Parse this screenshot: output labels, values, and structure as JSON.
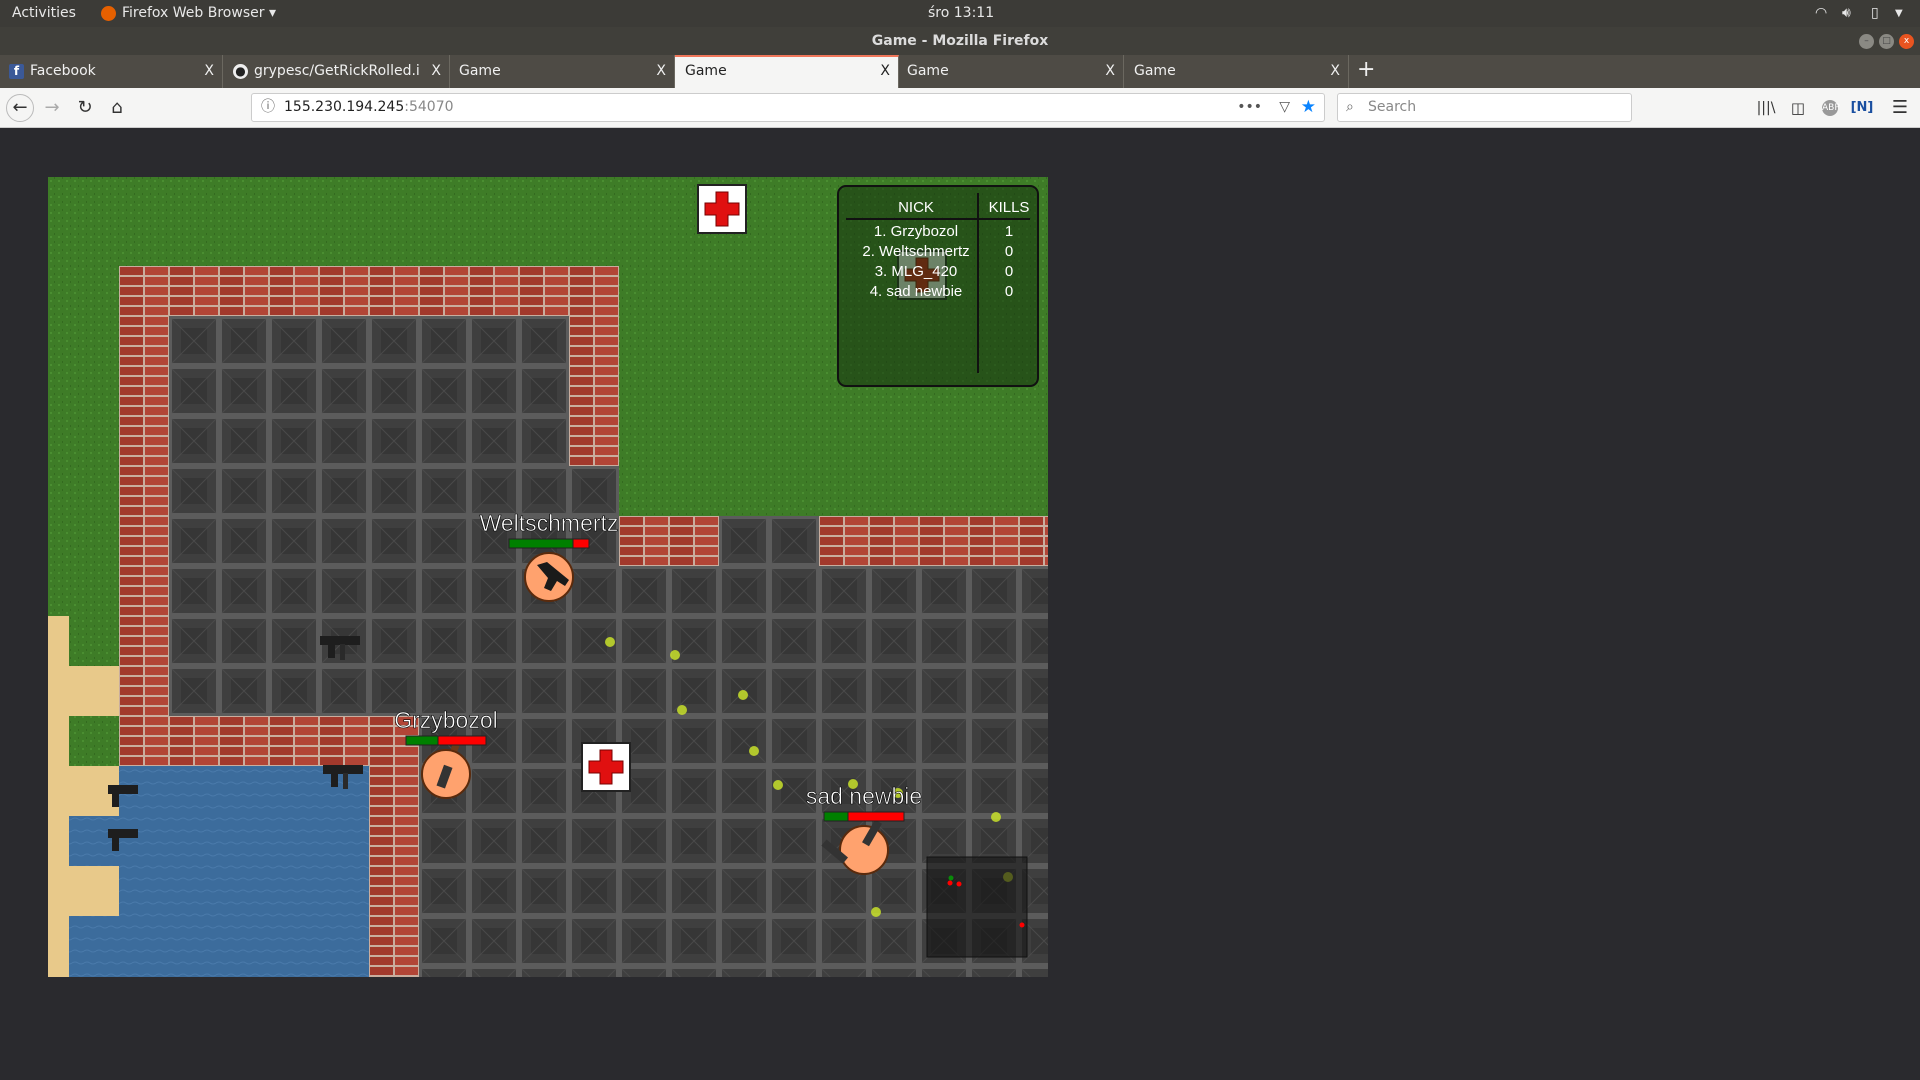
{
  "system_bar": {
    "activities": "Activities",
    "app_menu": "Firefox Web Browser ▾",
    "clock": "śro 13:11"
  },
  "window": {
    "title": "Game - Mozilla Firefox"
  },
  "tabs": [
    {
      "label": "Facebook",
      "icon": "facebook-icon"
    },
    {
      "label": "grypesc/GetRickRolled.i",
      "icon": "github-icon"
    },
    {
      "label": "Game"
    },
    {
      "label": "Game",
      "active": true
    },
    {
      "label": "Game"
    },
    {
      "label": "Game"
    }
  ],
  "nav": {
    "url_host": "155.230.194.245",
    "url_port": ":54070",
    "search_placeholder": "Search"
  },
  "game": {
    "scoreboard": {
      "headers": [
        "NICK",
        "KILLS"
      ],
      "rows": [
        {
          "nick": "1. Grzybozol",
          "kills": "1"
        },
        {
          "nick": "2. Weltschmertz",
          "kills": "0"
        },
        {
          "nick": "3. MLG_420",
          "kills": "0"
        },
        {
          "nick": "4. sad newbie",
          "kills": "0"
        }
      ]
    },
    "players": [
      {
        "name": "Weltschmertz",
        "health": 0.8,
        "weapon": "uzi"
      },
      {
        "name": "Grzybozol",
        "health": 0.4,
        "weapon": "ak47"
      },
      {
        "name": "sad newbie",
        "health": 0.3,
        "weapon": "dual-pistols"
      }
    ],
    "colors": {
      "health": "#008000",
      "damage": "#ff0000",
      "player": "#ffa26e",
      "bullet": "#c8e02a"
    }
  }
}
